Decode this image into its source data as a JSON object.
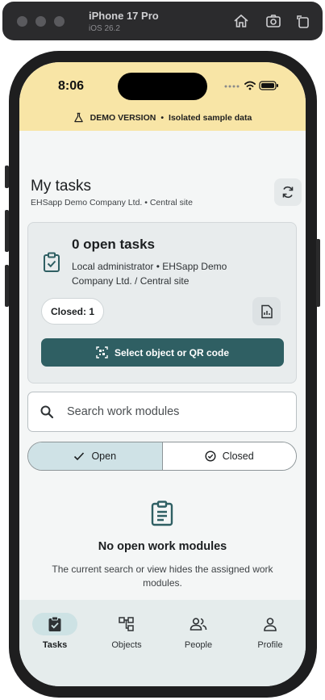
{
  "simulator": {
    "title": "iPhone 17 Pro",
    "subtitle": "iOS 26.2"
  },
  "status_bar": {
    "time": "8:06"
  },
  "demo_banner": {
    "label": "DEMO VERSION",
    "separator": "•",
    "detail": "Isolated sample data"
  },
  "header": {
    "title": "My tasks",
    "subtitle": "EHSapp Demo Company Ltd. • Central site"
  },
  "task_card": {
    "title": "0 open tasks",
    "description": "Local administrator • EHSapp Demo Company Ltd. / Central site",
    "closed_label": "Closed: 1",
    "primary_action": "Select object or QR code"
  },
  "search": {
    "placeholder": "Search work modules",
    "value": ""
  },
  "filter": {
    "open_label": "Open",
    "closed_label": "Closed",
    "selected": "Open"
  },
  "empty_state": {
    "title": "No open work modules",
    "description": "The current search or view hides the assigned work modules."
  },
  "tabs": [
    {
      "label": "Tasks",
      "icon": "clipboard-check-icon",
      "active": true
    },
    {
      "label": "Objects",
      "icon": "hierarchy-icon",
      "active": false
    },
    {
      "label": "People",
      "icon": "people-icon",
      "active": false
    },
    {
      "label": "Profile",
      "icon": "person-icon",
      "active": false
    }
  ],
  "colors": {
    "banner": "#f8e5a6",
    "primary": "#2f5f63",
    "accent_light": "#cfe2e6",
    "background": "#f4f6f6",
    "tabbar": "#e5ecec"
  }
}
